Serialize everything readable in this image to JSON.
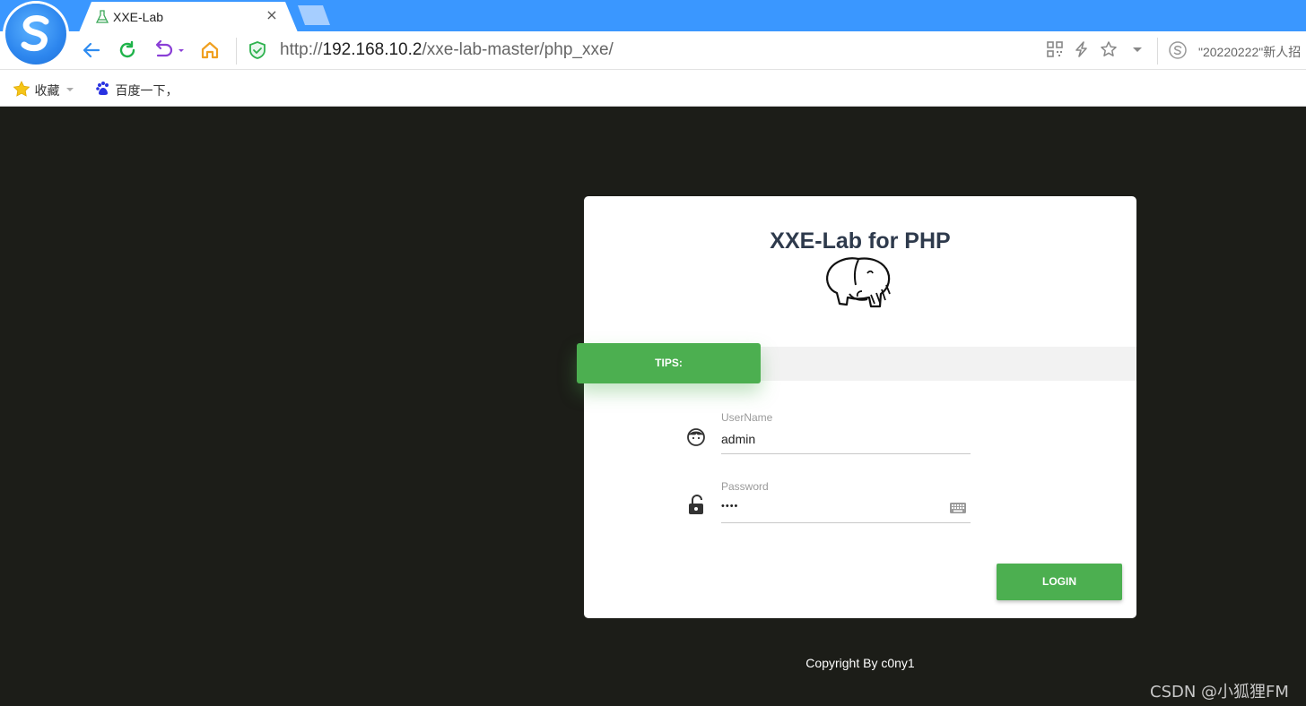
{
  "browser": {
    "tab": {
      "title": "XXE-Lab",
      "close_glyph": "×"
    },
    "address": {
      "scheme": "http://",
      "host": "192.168.10.2",
      "path": "/xxe-lab-master/php_xxe/"
    },
    "search_hint": "\"20220222\"新人招",
    "bookmarks": [
      {
        "label": "收藏",
        "icon": "star-icon"
      },
      {
        "label": "百度一下，",
        "icon": "baidu-paw-icon"
      }
    ],
    "colors": {
      "tabbar": "#3a97ff",
      "back": "#2f8cf0",
      "refresh": "#1fb34a",
      "undo": "#8a3fd6",
      "home": "#f0a020"
    }
  },
  "page": {
    "title": "XXE-Lab for PHP",
    "logo_icon": "php-elephant-icon",
    "tips_label": "TIPS:",
    "username": {
      "label": "UserName",
      "value": "admin",
      "icon": "user-face-icon"
    },
    "password": {
      "label": "Password",
      "value": "••••",
      "icon": "unlock-icon",
      "keyboard_icon": "keyboard-icon"
    },
    "login_label": "LOGIN",
    "copyright": "Copyright By c0ny1",
    "colors": {
      "background": "#1c1d18",
      "accent": "#4caf50",
      "title": "#2e3a4c"
    }
  },
  "watermark": "CSDN @小狐狸FM"
}
